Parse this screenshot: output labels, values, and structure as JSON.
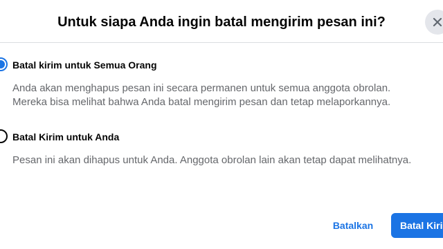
{
  "dialog": {
    "title": "Untuk siapa Anda ingin batal mengirim pesan ini?",
    "close_icon": "close-icon"
  },
  "options": [
    {
      "label": "Batal kirim untuk Semua Orang",
      "description": "Anda akan menghapus pesan ini secara permanen untuk semua anggota obrolan. Mereka bisa melihat bahwa Anda batal mengirim pesan dan tetap melaporkannya.",
      "selected": true
    },
    {
      "label": "Batal Kirim untuk Anda",
      "description": "Pesan ini akan dihapus untuk Anda. Anggota obrolan lain akan tetap dapat melihatnya.",
      "selected": false
    }
  ],
  "footer": {
    "cancel_label": "Batalkan",
    "confirm_label": "Batal Kirim"
  },
  "colors": {
    "accent": "#1b74e4",
    "secondary_text": "#65676b",
    "primary_text": "#050505",
    "divider": "#dadde1"
  }
}
